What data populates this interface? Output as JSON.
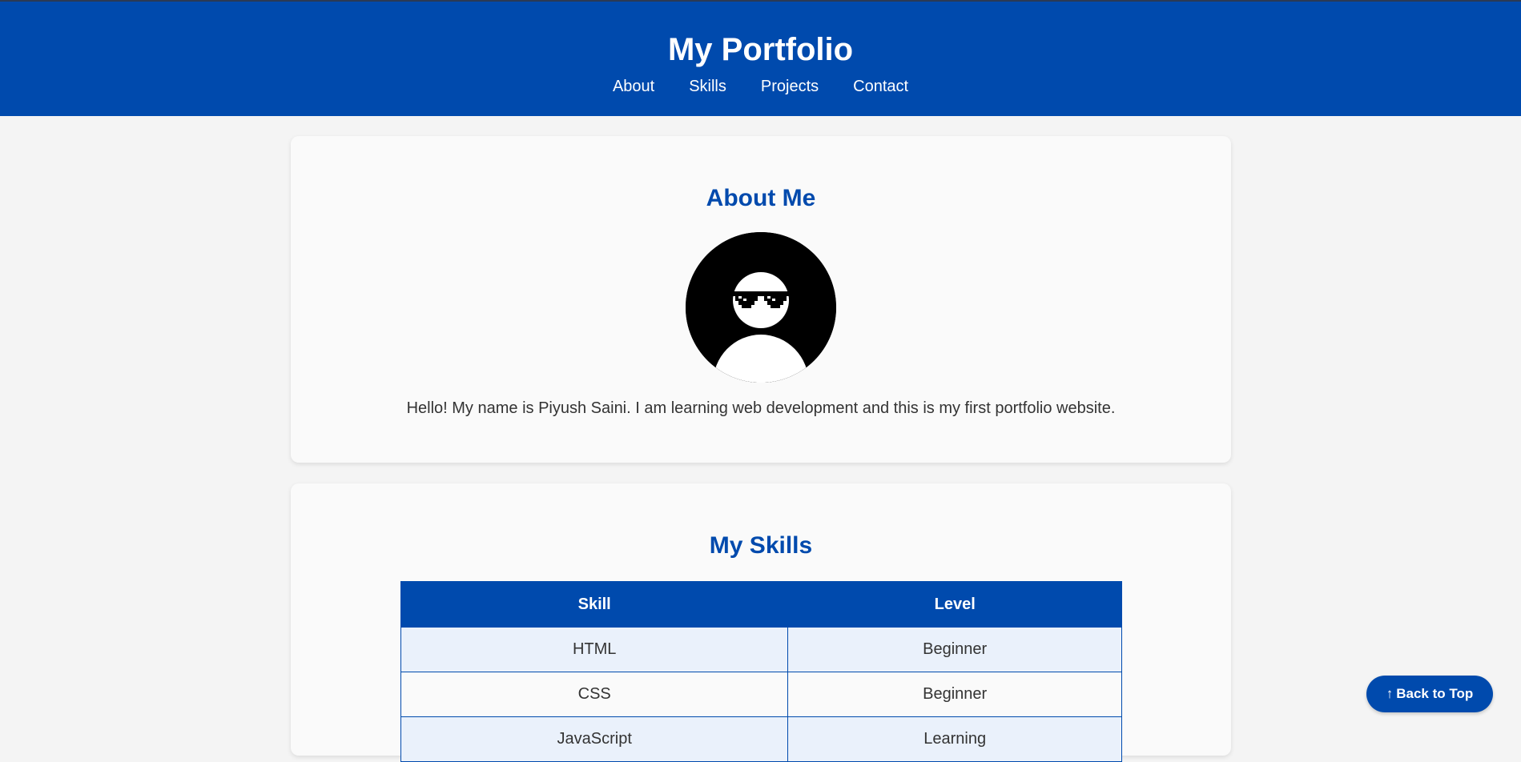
{
  "header": {
    "title": "My Portfolio",
    "nav": [
      "About",
      "Skills",
      "Projects",
      "Contact"
    ]
  },
  "about": {
    "heading": "About Me",
    "avatar_icon": "profile-avatar-with-pixel-sunglasses",
    "text": "Hello! My name is Piyush Saini. I am learning web development and this is my first portfolio website."
  },
  "skills": {
    "heading": "My Skills",
    "columns": [
      "Skill",
      "Level"
    ],
    "rows": [
      [
        "HTML",
        "Beginner"
      ],
      [
        "CSS",
        "Beginner"
      ],
      [
        "JavaScript",
        "Learning"
      ]
    ]
  },
  "back_to_top": {
    "icon": "↑",
    "label": "Back to Top"
  },
  "colors": {
    "primary": "#004aad",
    "page_background": "#f4f4f4",
    "card_background": "#fafafa",
    "row_alt": "#eaf1fb"
  }
}
